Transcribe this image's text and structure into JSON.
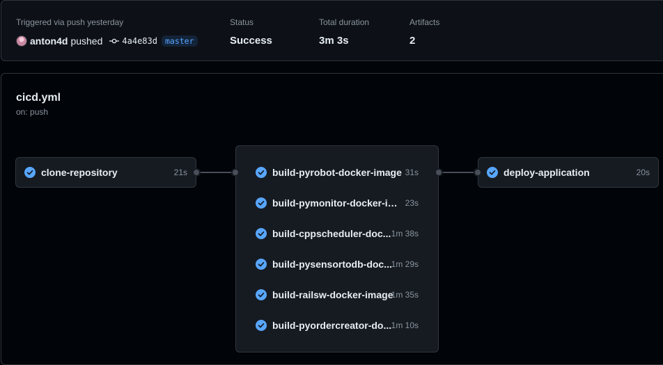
{
  "summary": {
    "trigger_label": "Triggered via push yesterday",
    "user": "anton4d",
    "action": "pushed",
    "commit_sha": "4a4e83d",
    "branch": "master",
    "status_label": "Status",
    "status_value": "Success",
    "duration_label": "Total duration",
    "duration_value": "3m 3s",
    "artifacts_label": "Artifacts",
    "artifacts_value": "2"
  },
  "workflow": {
    "name": "cicd.yml",
    "trigger": "on: push"
  },
  "jobs": {
    "clone": {
      "name": "clone-repository",
      "time": "21s",
      "status": "success"
    },
    "builds": [
      {
        "name": "build-pyrobot-docker-image",
        "time": "31s",
        "status": "success"
      },
      {
        "name": "build-pymonitor-docker-im...",
        "time": "23s",
        "status": "success"
      },
      {
        "name": "build-cppscheduler-doc...",
        "time": "1m 38s",
        "status": "success"
      },
      {
        "name": "build-pysensortodb-doc...",
        "time": "1m 29s",
        "status": "success"
      },
      {
        "name": "build-railsw-docker-image",
        "time": "1m 35s",
        "status": "success"
      },
      {
        "name": "build-pyordercreator-do...",
        "time": "1m 10s",
        "status": "success"
      }
    ],
    "deploy": {
      "name": "deploy-application",
      "time": "20s",
      "status": "success"
    }
  },
  "colors": {
    "success": "#58a6ff",
    "branch": "#58a6ff",
    "background": "#010409"
  },
  "icons": {
    "status": "check-circle-fill-icon",
    "commit": "git-commit-icon"
  }
}
